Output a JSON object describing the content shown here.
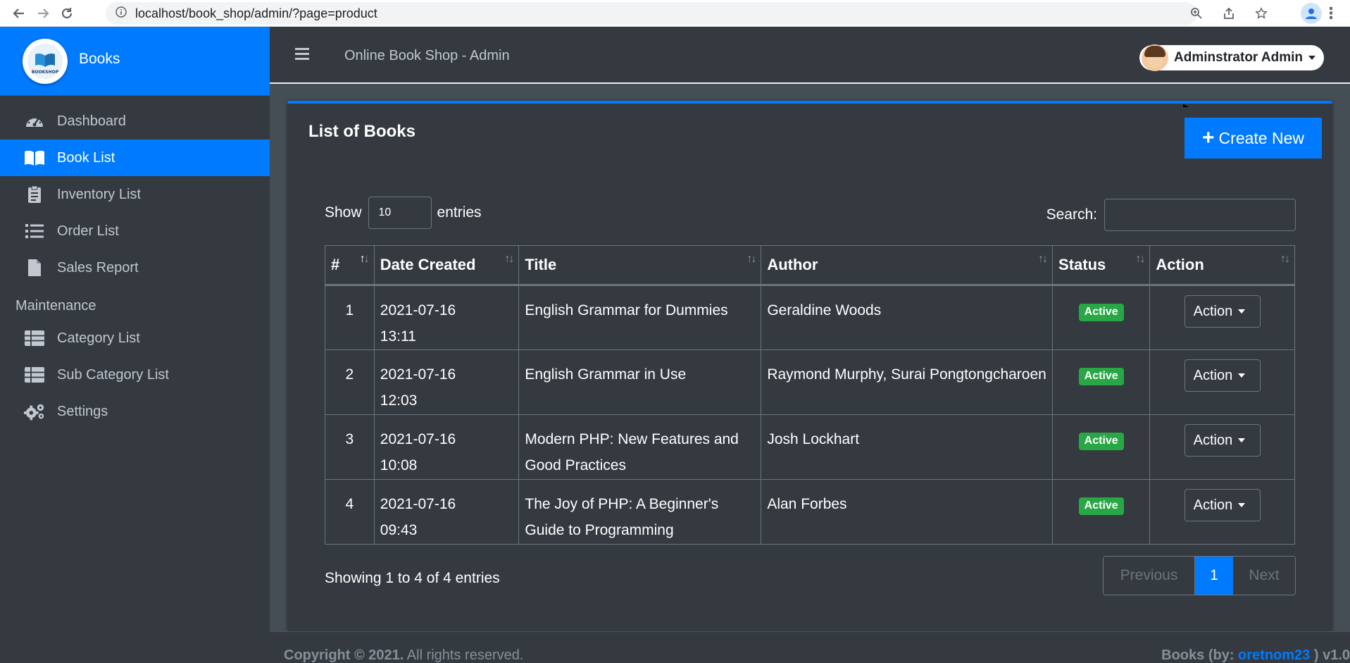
{
  "browser": {
    "url": "localhost/book_shop/admin/?page=product"
  },
  "sidebar": {
    "brand": "Books",
    "logo_text": "BOOKSHOP",
    "items": [
      {
        "label": "Dashboard",
        "icon": "tachometer-icon"
      },
      {
        "label": "Book List",
        "icon": "book-open-icon",
        "active": true
      },
      {
        "label": "Inventory List",
        "icon": "clipboard-icon"
      },
      {
        "label": "Order List",
        "icon": "list-icon"
      },
      {
        "label": "Sales Report",
        "icon": "file-icon"
      }
    ],
    "maintenance_header": "Maintenance",
    "maintenance_items": [
      {
        "label": "Category List",
        "icon": "table-icon"
      },
      {
        "label": "Sub Category List",
        "icon": "table-icon"
      },
      {
        "label": "Settings",
        "icon": "cogs-icon"
      }
    ]
  },
  "topnav": {
    "title": "Online Book Shop - Admin",
    "user_name": "Adminstrator Admin"
  },
  "card": {
    "title": "List of Books",
    "create_label": "Create New"
  },
  "datatable": {
    "show_label": "Show",
    "length_value": "10",
    "entries_label": "entries",
    "search_label": "Search:",
    "headers": [
      "#",
      "Date Created",
      "Title",
      "Author",
      "Status",
      "Action"
    ],
    "rows": [
      {
        "num": "1",
        "date": "2021-07-16",
        "time": "13:11",
        "title": "English Grammar for Dummies",
        "author": "Geraldine Woods",
        "status": "Active",
        "action": "Action"
      },
      {
        "num": "2",
        "date": "2021-07-16",
        "time": "12:03",
        "title": "English Grammar in Use",
        "author": "Raymond Murphy, Surai Pongtongcharoen",
        "status": "Active",
        "action": "Action"
      },
      {
        "num": "3",
        "date": "2021-07-16",
        "time": "10:08",
        "title": "Modern PHP: New Features and Good Practices",
        "author": "Josh Lockhart",
        "status": "Active",
        "action": "Action"
      },
      {
        "num": "4",
        "date": "2021-07-16",
        "time": "09:43",
        "title": "The Joy of PHP: A Beginner's Guide to Programming",
        "author": "Alan Forbes",
        "status": "Active",
        "action": "Action"
      }
    ],
    "info": "Showing 1 to 4 of 4 entries",
    "prev_label": "Previous",
    "page": "1",
    "next_label": "Next"
  },
  "footer": {
    "copyright_bold": "Copyright © 2021.",
    "copyright_rest": " All rights reserved.",
    "right_prefix": "Books (by: ",
    "right_link": "oretnom23",
    "right_suffix": " ) v1.0"
  },
  "colors": {
    "primary": "#007bff",
    "sidebar_bg": "#343a40",
    "content_bg": "#454d55",
    "success": "#28a745"
  }
}
